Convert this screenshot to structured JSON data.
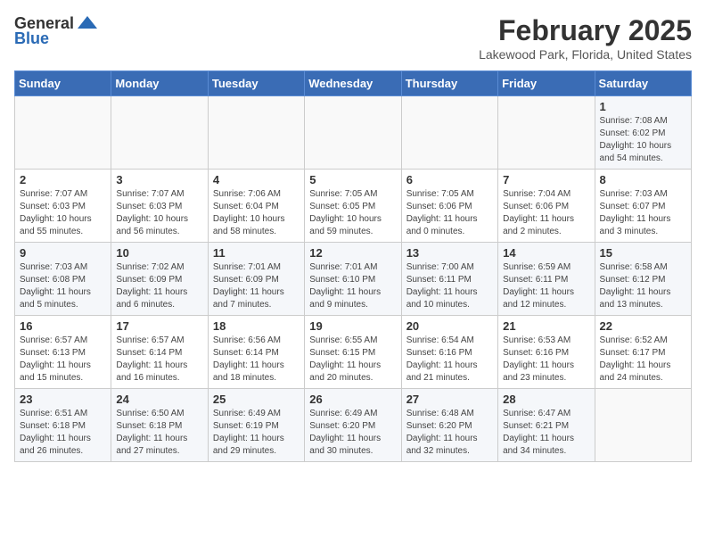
{
  "header": {
    "logo_general": "General",
    "logo_blue": "Blue",
    "month_title": "February 2025",
    "location": "Lakewood Park, Florida, United States"
  },
  "weekdays": [
    "Sunday",
    "Monday",
    "Tuesday",
    "Wednesday",
    "Thursday",
    "Friday",
    "Saturday"
  ],
  "weeks": [
    [
      {
        "day": "",
        "info": ""
      },
      {
        "day": "",
        "info": ""
      },
      {
        "day": "",
        "info": ""
      },
      {
        "day": "",
        "info": ""
      },
      {
        "day": "",
        "info": ""
      },
      {
        "day": "",
        "info": ""
      },
      {
        "day": "1",
        "info": "Sunrise: 7:08 AM\nSunset: 6:02 PM\nDaylight: 10 hours\nand 54 minutes."
      }
    ],
    [
      {
        "day": "2",
        "info": "Sunrise: 7:07 AM\nSunset: 6:03 PM\nDaylight: 10 hours\nand 55 minutes."
      },
      {
        "day": "3",
        "info": "Sunrise: 7:07 AM\nSunset: 6:03 PM\nDaylight: 10 hours\nand 56 minutes."
      },
      {
        "day": "4",
        "info": "Sunrise: 7:06 AM\nSunset: 6:04 PM\nDaylight: 10 hours\nand 58 minutes."
      },
      {
        "day": "5",
        "info": "Sunrise: 7:05 AM\nSunset: 6:05 PM\nDaylight: 10 hours\nand 59 minutes."
      },
      {
        "day": "6",
        "info": "Sunrise: 7:05 AM\nSunset: 6:06 PM\nDaylight: 11 hours\nand 0 minutes."
      },
      {
        "day": "7",
        "info": "Sunrise: 7:04 AM\nSunset: 6:06 PM\nDaylight: 11 hours\nand 2 minutes."
      },
      {
        "day": "8",
        "info": "Sunrise: 7:03 AM\nSunset: 6:07 PM\nDaylight: 11 hours\nand 3 minutes."
      }
    ],
    [
      {
        "day": "9",
        "info": "Sunrise: 7:03 AM\nSunset: 6:08 PM\nDaylight: 11 hours\nand 5 minutes."
      },
      {
        "day": "10",
        "info": "Sunrise: 7:02 AM\nSunset: 6:09 PM\nDaylight: 11 hours\nand 6 minutes."
      },
      {
        "day": "11",
        "info": "Sunrise: 7:01 AM\nSunset: 6:09 PM\nDaylight: 11 hours\nand 7 minutes."
      },
      {
        "day": "12",
        "info": "Sunrise: 7:01 AM\nSunset: 6:10 PM\nDaylight: 11 hours\nand 9 minutes."
      },
      {
        "day": "13",
        "info": "Sunrise: 7:00 AM\nSunset: 6:11 PM\nDaylight: 11 hours\nand 10 minutes."
      },
      {
        "day": "14",
        "info": "Sunrise: 6:59 AM\nSunset: 6:11 PM\nDaylight: 11 hours\nand 12 minutes."
      },
      {
        "day": "15",
        "info": "Sunrise: 6:58 AM\nSunset: 6:12 PM\nDaylight: 11 hours\nand 13 minutes."
      }
    ],
    [
      {
        "day": "16",
        "info": "Sunrise: 6:57 AM\nSunset: 6:13 PM\nDaylight: 11 hours\nand 15 minutes."
      },
      {
        "day": "17",
        "info": "Sunrise: 6:57 AM\nSunset: 6:14 PM\nDaylight: 11 hours\nand 16 minutes."
      },
      {
        "day": "18",
        "info": "Sunrise: 6:56 AM\nSunset: 6:14 PM\nDaylight: 11 hours\nand 18 minutes."
      },
      {
        "day": "19",
        "info": "Sunrise: 6:55 AM\nSunset: 6:15 PM\nDaylight: 11 hours\nand 20 minutes."
      },
      {
        "day": "20",
        "info": "Sunrise: 6:54 AM\nSunset: 6:16 PM\nDaylight: 11 hours\nand 21 minutes."
      },
      {
        "day": "21",
        "info": "Sunrise: 6:53 AM\nSunset: 6:16 PM\nDaylight: 11 hours\nand 23 minutes."
      },
      {
        "day": "22",
        "info": "Sunrise: 6:52 AM\nSunset: 6:17 PM\nDaylight: 11 hours\nand 24 minutes."
      }
    ],
    [
      {
        "day": "23",
        "info": "Sunrise: 6:51 AM\nSunset: 6:18 PM\nDaylight: 11 hours\nand 26 minutes."
      },
      {
        "day": "24",
        "info": "Sunrise: 6:50 AM\nSunset: 6:18 PM\nDaylight: 11 hours\nand 27 minutes."
      },
      {
        "day": "25",
        "info": "Sunrise: 6:49 AM\nSunset: 6:19 PM\nDaylight: 11 hours\nand 29 minutes."
      },
      {
        "day": "26",
        "info": "Sunrise: 6:49 AM\nSunset: 6:20 PM\nDaylight: 11 hours\nand 30 minutes."
      },
      {
        "day": "27",
        "info": "Sunrise: 6:48 AM\nSunset: 6:20 PM\nDaylight: 11 hours\nand 32 minutes."
      },
      {
        "day": "28",
        "info": "Sunrise: 6:47 AM\nSunset: 6:21 PM\nDaylight: 11 hours\nand 34 minutes."
      },
      {
        "day": "",
        "info": ""
      }
    ]
  ]
}
